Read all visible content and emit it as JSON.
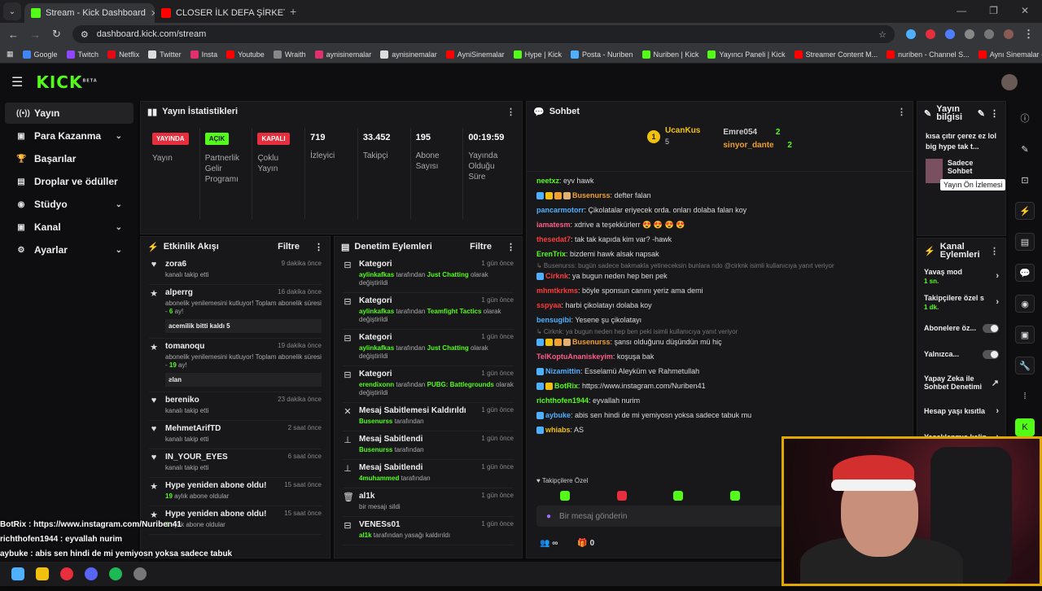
{
  "browser": {
    "tabs": [
      {
        "title": "Stream - Kick Dashboard",
        "active": true,
        "fav_color": "#53fc18"
      },
      {
        "title": "CLOSER İLK DEFA ŞİRKETİN OĞ",
        "active": false,
        "fav_color": "#ff0000"
      }
    ],
    "url": "dashboard.kick.com/stream",
    "bookmarks": [
      "Google",
      "Twitch",
      "Netflix",
      "Twitter",
      "Insta",
      "Youtube",
      "Wraith",
      "aynisinemalar",
      "aynisinemalar",
      "AyniSinemalar",
      "Hype | Kick",
      "Posta - Nuriben",
      "Nuriben | Kick",
      "Yayıncı Paneli | Kick",
      "Streamer Content M...",
      "nuriben - Channel S...",
      "Aynı Sinemalar - Ça..."
    ]
  },
  "kick": {
    "logo": "KICK",
    "beta": "BETA"
  },
  "sidebar": {
    "items": [
      {
        "label": "Yayın",
        "icon": "broadcast-icon",
        "active": true
      },
      {
        "label": "Para Kazanma",
        "icon": "money-icon",
        "chev": true
      },
      {
        "label": "Başarılar",
        "icon": "trophy-icon"
      },
      {
        "label": "Droplar ve ödüller",
        "icon": "gift-icon"
      },
      {
        "label": "Stüdyo",
        "icon": "studio-icon",
        "chev": true
      },
      {
        "label": "Kanal",
        "icon": "channel-icon",
        "chev": true
      },
      {
        "label": "Ayarlar",
        "icon": "gear-icon",
        "chev": true
      }
    ]
  },
  "stats": {
    "title": "Yayın İstatistikleri",
    "items": [
      {
        "badge": "YAYINDA",
        "badge_color": "red",
        "label": "Yayın"
      },
      {
        "badge": "AÇIK",
        "badge_color": "green",
        "label": "Partnerlik Gelir Programı"
      },
      {
        "badge": "KAPALI",
        "badge_color": "red",
        "label": "Çoklu Yayın"
      },
      {
        "value": "719",
        "label": "İzleyici"
      },
      {
        "value": "33.452",
        "label": "Takipçi"
      },
      {
        "value": "195",
        "label": "Abone Sayısı"
      },
      {
        "value": "00:19:59",
        "label": "Yayında Olduğu Süre"
      }
    ]
  },
  "activity": {
    "title": "Etkinlik Akışı",
    "filter": "Filtre",
    "items": [
      {
        "icon": "heart-icon",
        "name": "zora6",
        "sub": "kanalı takip etti",
        "time": "9 dakika önce"
      },
      {
        "icon": "star-icon",
        "name": "alperrg",
        "sub": "abonelik yenilemesini kutluyor! Toplam abonelik süresi - ",
        "months": "6",
        "sub2": " ay!",
        "time": "16 dakika önce",
        "box": "acemilik bitti kaldı 5"
      },
      {
        "icon": "star-icon",
        "name": "tomanoqu",
        "sub": "abonelik yenilemesini kutluyor! Toplam abonelik süresi - ",
        "months": "19",
        "sub2": " ay!",
        "time": "19 dakika önce",
        "box": "ƨlan"
      },
      {
        "icon": "heart-icon",
        "name": "bereniko",
        "sub": "kanalı takip etti",
        "time": "23 dakika önce"
      },
      {
        "icon": "heart-icon",
        "name": "MehmetArifTD",
        "sub": "kanalı takip etti",
        "time": "2 saat önce"
      },
      {
        "icon": "heart-icon",
        "name": "IN_YOUR_EYES",
        "sub": "kanalı takip etti",
        "time": "6 saat önce"
      },
      {
        "icon": "star-icon",
        "name": "Hype yeniden abone oldu!",
        "sub": "",
        "months": "19",
        "sub2": " aylık abone oldular",
        "time": "15 saat önce"
      },
      {
        "icon": "star-icon",
        "name": "Hype yeniden abone oldu!",
        "sub": "",
        "months": "1",
        "sub2": " aylık abone oldular",
        "time": "15 saat önce"
      }
    ]
  },
  "moderation": {
    "title": "Denetim Eylemleri",
    "filter": "Filtre",
    "items": [
      {
        "icon": "category-icon",
        "name": "Kategori",
        "user": "aylinkafkas",
        "mid": " tarafından ",
        "game": "Just Chatting",
        "end": " olarak değiştirildi",
        "time": "1 gün önce"
      },
      {
        "icon": "category-icon",
        "name": "Kategori",
        "user": "aylinkafkas",
        "mid": " tarafından ",
        "game": "Teamfight Tactics",
        "end": " olarak değiştirildi",
        "time": "1 gün önce"
      },
      {
        "icon": "category-icon",
        "name": "Kategori",
        "user": "aylinkafkas",
        "mid": " tarafından ",
        "game": "Just Chatting",
        "end": " olarak değiştirildi",
        "time": "1 gün önce"
      },
      {
        "icon": "category-icon",
        "name": "Kategori",
        "user": "erendixonn",
        "mid": " tarafından ",
        "game": "PUBG: Battlegrounds",
        "end": " olarak değiştirildi",
        "time": "1 gün önce"
      },
      {
        "icon": "unpin-icon",
        "name": "Mesaj Sabitlemesi Kaldırıldı",
        "user": "Busenurss",
        "mid": " tarafından",
        "game": "",
        "end": "",
        "time": "1 gün önce"
      },
      {
        "icon": "pin-icon",
        "name": "Mesaj Sabitlendi",
        "user": "Busenurss",
        "mid": " tarafından",
        "game": "",
        "end": "",
        "time": "1 gün önce"
      },
      {
        "icon": "pin-icon",
        "name": "Mesaj Sabitlendi",
        "user": "4muhammed",
        "mid": " tarafından",
        "game": "",
        "end": "",
        "time": "1 gün önce"
      },
      {
        "icon": "trash-icon",
        "name": "al1k",
        "user": "",
        "mid": "bir mesajı sildi",
        "game": "",
        "end": "",
        "time": "1 gün önce"
      },
      {
        "icon": "ban-icon",
        "name": "VENESs01",
        "user": "al1k",
        "mid": " tarafından yasağı kaldırıldı",
        "game": "",
        "end": "",
        "time": "1 gün önce"
      }
    ]
  },
  "chat": {
    "title": "Sohbet",
    "top": [
      {
        "rank": "1",
        "name": "UcanKus",
        "count": "5"
      },
      {
        "name": "Emre054",
        "count": "2"
      },
      {
        "name": "sinyor_dante",
        "count": "2"
      }
    ],
    "messages": [
      {
        "user": "neetxz",
        "color": "#53fc18",
        "text": " eyv hawk"
      },
      {
        "user": "Busenurss",
        "color": "#f0a030",
        "text": " defter falan",
        "badges": 4
      },
      {
        "user": "pancarmotorr",
        "color": "#4fb0ff",
        "text": " Çikolatalar eriyecek orda. onları dolaba falan koy"
      },
      {
        "user": "iamatesm",
        "color": "#ff5c8a",
        "text": " xdrive a teşekkürlerr 😍 😍 😍 😍"
      },
      {
        "user": "thesedat7",
        "color": "#ff3b3b",
        "text": " tak tak kapıda kim var? -hawk"
      },
      {
        "user": "ErenTrix",
        "color": "#53fc18",
        "text": " bizdemi hawk alsak napsak"
      },
      {
        "reply": "↳ Busenurss: bugün sadece bakmakla yetineceksin bunlara ndo @cirknk isimli kullanıcıya yanıt veriyor"
      },
      {
        "user": "Cirknk",
        "color": "#ff3b3b",
        "text": " ya bugun neden hep ben pek",
        "badges": 1
      },
      {
        "user": "mhmtkrkms",
        "color": "#ff3b3b",
        "text": " böyle sponsun canını yeriz ama demi"
      },
      {
        "user": "sspyaa",
        "color": "#ff3b3b",
        "text": " harbi çikolatayı dolaba koy"
      },
      {
        "user": "bensugibi",
        "color": "#4fb0ff",
        "text": " Yesene şu çikolatayı"
      },
      {
        "reply": "↳ Cirknk: ya bugun neden hep ben peki  isimli kullanıcıya yanıt veriyor"
      },
      {
        "user": "Busenurss",
        "color": "#f0a030",
        "text": " şansı olduğunu düşündün mü hiç",
        "badges": 4
      },
      {
        "user": "TelKoptuAnaniskeyim",
        "color": "#ff5c8a",
        "text": " koşuşa bak"
      },
      {
        "user": "Nizamittin",
        "color": "#4fb0ff",
        "text": " Esselamü Aleyküm ve Rahmetullah",
        "badges": 1
      },
      {
        "user": "BotRix",
        "color": "#53fc18",
        "text": " https://www.instagram.com/Nuriben41",
        "badges": 2
      },
      {
        "user": "richthofen1944",
        "color": "#53fc18",
        "text": " eyvallah nurim"
      },
      {
        "user": "aybuke",
        "color": "#4fb0ff",
        "text": " abis sen hindi de mi yemiyosn yoksa sadece tabuk mu",
        "badges": 1
      },
      {
        "user": "whiabs",
        "color": "#f2c10d",
        "text": " AS",
        "badges": 1
      }
    ],
    "followers_only": "Takipçilere Özel",
    "input_placeholder": "Bir mesaj gönderin",
    "viewers": "∞",
    "points": "0"
  },
  "stream_info": {
    "title": "Yayın bilgisi",
    "desc": "kısa çıtır çerez ez lol big hype tak t...",
    "category": "Sadece Sohbet",
    "tooltip": "Yayın Ön İzlemesi"
  },
  "channel_actions": {
    "title": "Kanal Eylemleri",
    "items": [
      {
        "label": "Yavaş mod",
        "sub": "1 sn.",
        "kind": "chev"
      },
      {
        "label": "Takipçilere özel s",
        "sub": "1 dk.",
        "kind": "chev"
      },
      {
        "label": "Abonelere öz...",
        "kind": "toggle"
      },
      {
        "label": "Yalnızca...",
        "kind": "toggle"
      },
      {
        "label": "Yapay Zeka ile Sohbet Denetimi",
        "kind": "ext"
      },
      {
        "label": "Hesap yaşı kısıtla",
        "kind": "chev"
      },
      {
        "label": "Yasaklanmış kelin",
        "kind": "chev"
      }
    ]
  },
  "overlay": {
    "lines": [
      "BotRix : https://www.instagram.com/Nuriben41",
      "richthofen1944 : eyvallah nurim",
      "aybuke : abis sen hindi de mi yemiyosn yoksa sadece tabuk mu",
      "whiabs : AS"
    ]
  }
}
